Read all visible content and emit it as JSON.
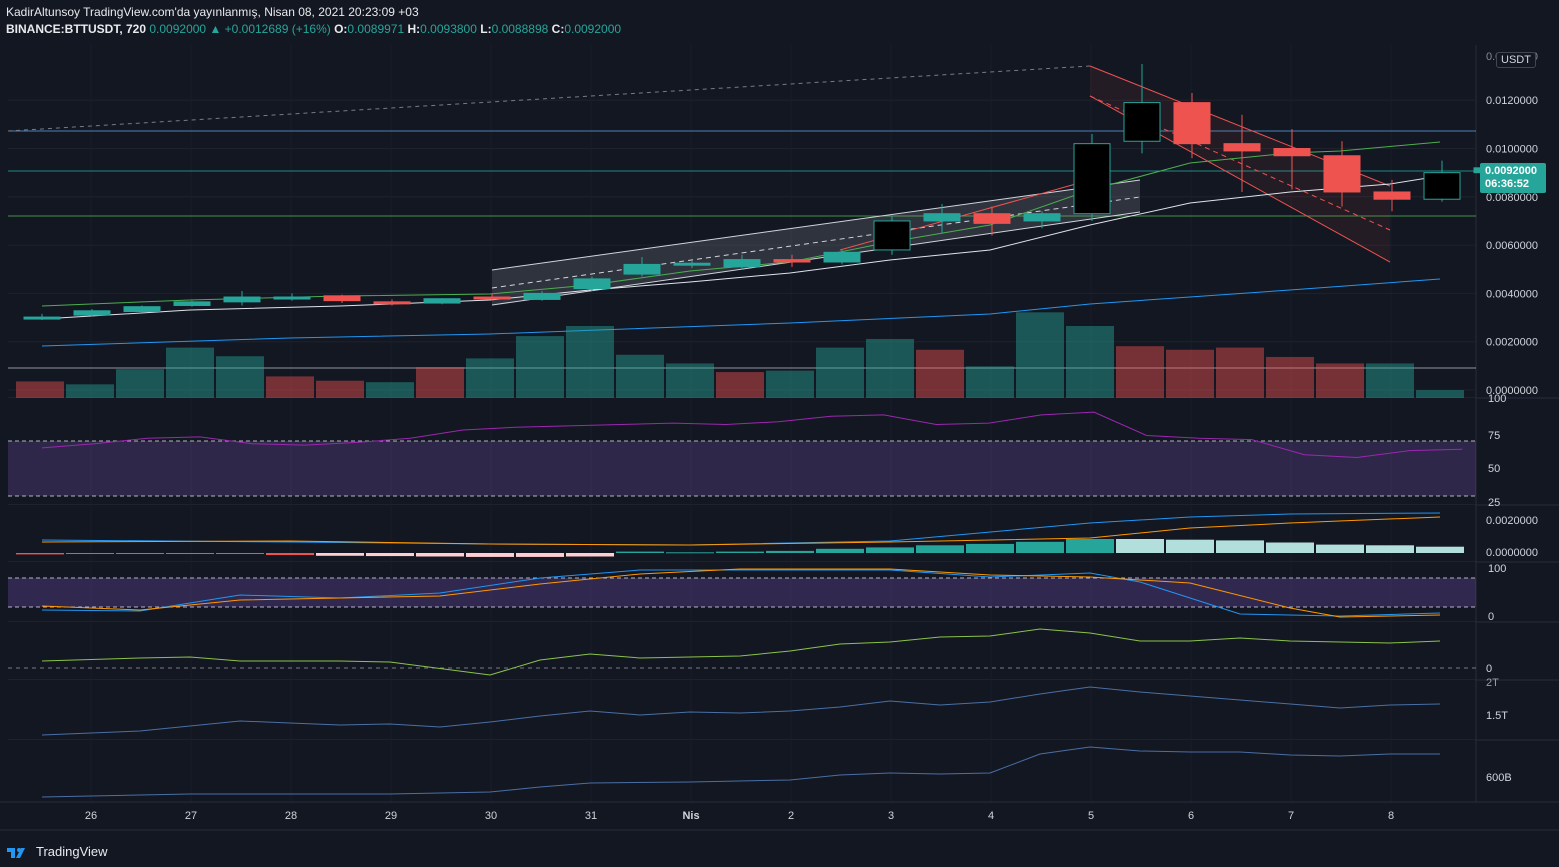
{
  "header": {
    "line1": "KadirAltunsoy TradingView.com'da yayınlanmış, Nisan 08, 2021 20:23:09 +03",
    "symbol": "BINANCE:BTTUSDT, 720",
    "last": "0.0092000",
    "change": "▲ +0.0012689 (+16%)",
    "o_label": "O:",
    "o_val": "0.0089971",
    "h_label": "H:",
    "h_val": "0.0093800",
    "l_label": "L:",
    "l_val": "0.0088898",
    "c_label": "C:",
    "c_val": "0.0092000"
  },
  "currency_badge": "USDT",
  "price_tag": {
    "price": "0.0092000",
    "countdown": "06:36:52"
  },
  "footer": {
    "brand": "TradingView"
  },
  "colors": {
    "up": "#26a69a",
    "down": "#ef5350",
    "background": "#131722",
    "rsi_line": "#9c27b0",
    "ma_blue": "#2196f3",
    "ma_green": "#4caf50"
  },
  "chart_data": {
    "type": "candlestick",
    "price_axis": {
      "ylim": [
        0.0,
        0.014
      ],
      "ticks": [
        "0.0000000",
        "0.0020000",
        "0.0040000",
        "0.0060000",
        "0.0080000",
        "0.0100000",
        "0.0120000"
      ],
      "top_partial": "0.0140000"
    },
    "x_ticks": [
      "26",
      "27",
      "28",
      "29",
      "30",
      "31",
      "Nis",
      "2",
      "3",
      "4",
      "5",
      "6",
      "7",
      "8"
    ],
    "candles": [
      {
        "o": 0.003,
        "h": 0.00315,
        "l": 0.0029,
        "c": 0.00302
      },
      {
        "o": 0.0031,
        "h": 0.00335,
        "l": 0.00305,
        "c": 0.00328
      },
      {
        "o": 0.00325,
        "h": 0.0035,
        "l": 0.0032,
        "c": 0.00345
      },
      {
        "o": 0.0035,
        "h": 0.0037,
        "l": 0.00345,
        "c": 0.00365
      },
      {
        "o": 0.00365,
        "h": 0.0041,
        "l": 0.0035,
        "c": 0.00385
      },
      {
        "o": 0.0038,
        "h": 0.004,
        "l": 0.0037,
        "c": 0.00385
      },
      {
        "o": 0.0039,
        "h": 0.00395,
        "l": 0.0036,
        "c": 0.0037
      },
      {
        "o": 0.00365,
        "h": 0.00375,
        "l": 0.0035,
        "c": 0.0036
      },
      {
        "o": 0.0036,
        "h": 0.0038,
        "l": 0.00355,
        "c": 0.00378
      },
      {
        "o": 0.00385,
        "h": 0.004,
        "l": 0.0037,
        "c": 0.0038
      },
      {
        "o": 0.00375,
        "h": 0.0041,
        "l": 0.0037,
        "c": 0.004
      },
      {
        "o": 0.0042,
        "h": 0.0047,
        "l": 0.0041,
        "c": 0.0046
      },
      {
        "o": 0.0048,
        "h": 0.0055,
        "l": 0.0047,
        "c": 0.0052
      },
      {
        "o": 0.0052,
        "h": 0.00535,
        "l": 0.00505,
        "c": 0.00525
      },
      {
        "o": 0.0051,
        "h": 0.0056,
        "l": 0.005,
        "c": 0.0054
      },
      {
        "o": 0.0054,
        "h": 0.0056,
        "l": 0.0051,
        "c": 0.0053
      },
      {
        "o": 0.0053,
        "h": 0.0058,
        "l": 0.0052,
        "c": 0.0057
      },
      {
        "o": 0.0058,
        "h": 0.0072,
        "l": 0.0056,
        "c": 0.007
      },
      {
        "o": 0.007,
        "h": 0.0077,
        "l": 0.0065,
        "c": 0.0073
      },
      {
        "o": 0.0073,
        "h": 0.0076,
        "l": 0.0064,
        "c": 0.0069
      },
      {
        "o": 0.007,
        "h": 0.0074,
        "l": 0.0067,
        "c": 0.0073
      },
      {
        "o": 0.0073,
        "h": 0.0106,
        "l": 0.007,
        "c": 0.0102
      },
      {
        "o": 0.0103,
        "h": 0.0135,
        "l": 0.0098,
        "c": 0.0119
      },
      {
        "o": 0.0119,
        "h": 0.0123,
        "l": 0.0096,
        "c": 0.0102
      },
      {
        "o": 0.0102,
        "h": 0.0114,
        "l": 0.0082,
        "c": 0.0099
      },
      {
        "o": 0.01,
        "h": 0.0108,
        "l": 0.0083,
        "c": 0.0097
      },
      {
        "o": 0.0097,
        "h": 0.0103,
        "l": 0.0076,
        "c": 0.0082
      },
      {
        "o": 0.0082,
        "h": 0.0087,
        "l": 0.0074,
        "c": 0.0079
      },
      {
        "o": 0.0079,
        "h": 0.0095,
        "l": 0.0078,
        "c": 0.009
      },
      {
        "o": 0.009,
        "h": 0.00938,
        "l": 0.00889,
        "c": 0.0092
      }
    ],
    "volume": [
      {
        "v": 0.46,
        "up": false
      },
      {
        "v": 0.38,
        "up": true
      },
      {
        "v": 0.8,
        "up": true
      },
      {
        "v": 1.4,
        "up": true
      },
      {
        "v": 1.16,
        "up": true
      },
      {
        "v": 0.6,
        "up": false
      },
      {
        "v": 0.48,
        "up": false
      },
      {
        "v": 0.44,
        "up": true
      },
      {
        "v": 0.86,
        "up": false
      },
      {
        "v": 1.1,
        "up": true
      },
      {
        "v": 1.72,
        "up": true
      },
      {
        "v": 2.0,
        "up": true
      },
      {
        "v": 1.2,
        "up": true
      },
      {
        "v": 0.96,
        "up": true
      },
      {
        "v": 0.72,
        "up": false
      },
      {
        "v": 0.76,
        "up": true
      },
      {
        "v": 1.4,
        "up": true
      },
      {
        "v": 1.64,
        "up": true
      },
      {
        "v": 1.34,
        "up": false
      },
      {
        "v": 0.88,
        "up": true
      },
      {
        "v": 2.38,
        "up": true
      },
      {
        "v": 2.0,
        "up": true
      },
      {
        "v": 1.44,
        "up": false
      },
      {
        "v": 1.34,
        "up": false
      },
      {
        "v": 1.4,
        "up": false
      },
      {
        "v": 1.14,
        "up": false
      },
      {
        "v": 0.96,
        "up": false
      },
      {
        "v": 0.96,
        "up": true
      },
      {
        "v": 0.22,
        "up": true
      }
    ],
    "rsi": {
      "ticks": [
        "100",
        "75",
        "50",
        "25"
      ],
      "values": [
        65,
        68,
        72,
        73,
        68,
        67,
        69,
        72,
        78,
        80,
        81,
        82,
        83,
        82,
        84,
        88,
        89,
        82,
        83,
        89,
        91,
        74,
        72,
        71,
        60,
        58,
        63,
        64
      ]
    },
    "macd": {
      "ticks": [
        "0.0020000",
        "0.0000000"
      ]
    },
    "stoch": {
      "ticks": [
        "100",
        "0"
      ]
    },
    "osc": {
      "ticks": [
        "0"
      ]
    },
    "obv": {
      "ticks": [
        "1.5T",
        "2T"
      ]
    },
    "vol2": {
      "ticks": [
        "600B"
      ]
    }
  }
}
